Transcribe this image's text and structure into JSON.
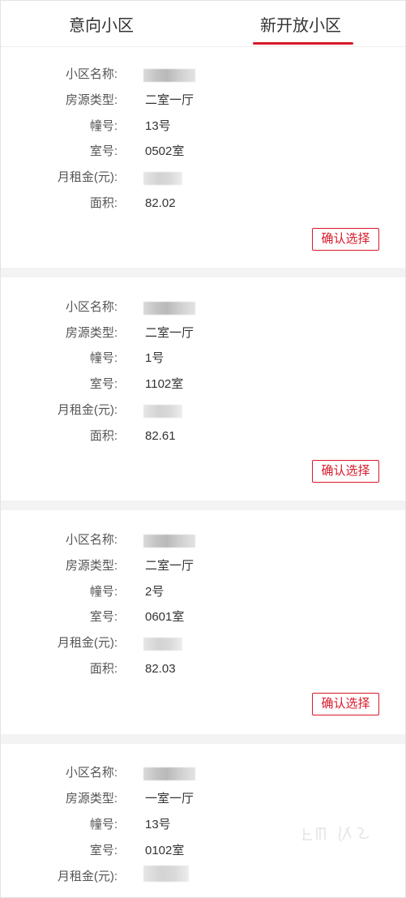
{
  "tabs": [
    {
      "label": "意向小区",
      "active": false
    },
    {
      "label": "新开放小区",
      "active": true
    }
  ],
  "accent_color": "#d7192a",
  "labels": {
    "community": "小区名称:",
    "type": "房源类型:",
    "building": "幢号:",
    "room": "室号:",
    "rent": "月租金(元):",
    "area": "面积:"
  },
  "confirm_label": "确认选择",
  "listings": [
    {
      "type": "二室一厅",
      "building": "13号",
      "room": "0502室",
      "area": "82.02"
    },
    {
      "type": "二室一厅",
      "building": "1号",
      "room": "1102室",
      "area": "82.61"
    },
    {
      "type": "二室一厅",
      "building": "2号",
      "room": "0601室",
      "area": "82.03"
    },
    {
      "type": "一室一厅",
      "building": "13号",
      "room": "0102室"
    }
  ],
  "watermark_icon": "logo-watermark-icon"
}
